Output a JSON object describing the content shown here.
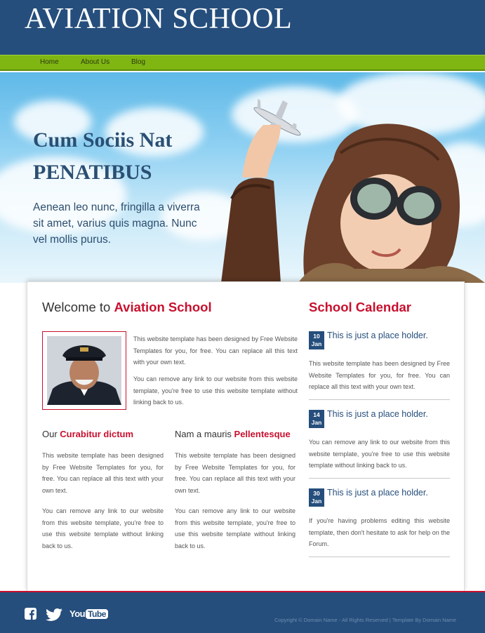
{
  "header": {
    "site_title": "AVIATION SCHOOL"
  },
  "nav": {
    "items": [
      "Home",
      "About Us",
      "Blog"
    ]
  },
  "hero": {
    "title_line1": "Cum Sociis Nat",
    "title_line2": "PENATIBUS",
    "text": "Aenean leo nunc, fringilla a viverra sit amet, varius quis magna. Nunc vel mollis purus."
  },
  "welcome": {
    "title_prefix": "Welcome to ",
    "title_highlight": "Aviation School",
    "para1": "This website template has been designed by Free Website Templates for you, for free. You can replace all this text with your own text.",
    "para2": "You can remove any link to our website from this website template, you're free to use this website template without linking back to us."
  },
  "col1": {
    "title_prefix": "Our ",
    "title_highlight": "Curabitur dictum",
    "para1": "This website template has been designed by Free Website Templates for you, for free. You can replace all this text with your own text.",
    "para2": "You can remove any link to our website from this website template, you're free to use this website template without linking back to us."
  },
  "col2": {
    "title_prefix": "Nam a mauris ",
    "title_highlight": "Pellentesque",
    "para1": "This website template has been designed by Free Website Templates for you, for free. You can replace all this text with your own text.",
    "para2": "You can remove any link to our website from this website template, you're free to use this website template without linking back to us."
  },
  "calendar": {
    "title": "School Calendar",
    "events": [
      {
        "day": "10",
        "month": "Jan",
        "heading": "This is just a place holder.",
        "text": "This website template has been designed by Free Website Templates for you, for free. You can replace all this text with your own text."
      },
      {
        "day": "14",
        "month": "Jan",
        "heading": "This is just a place holder.",
        "text": "You can remove any link to our website from this website template, you're free to use this website template without linking back to us."
      },
      {
        "day": "30",
        "month": "Jan",
        "heading": "This is just a place holder.",
        "text": "If you're having problems editing this website template, then don't hesitate to ask for help on the Forum."
      }
    ]
  },
  "footer": {
    "copyright": "Copyright © Domain Name - All Rights Reserved | Template By Domain Name",
    "social": [
      "facebook-icon",
      "twitter-icon",
      "youtube-icon"
    ],
    "youtube_label": "You",
    "youtube_label2": "Tube"
  },
  "colors": {
    "header_bg": "#254e7c",
    "nav_green": "#7fb612",
    "accent_red": "#c8102e"
  }
}
